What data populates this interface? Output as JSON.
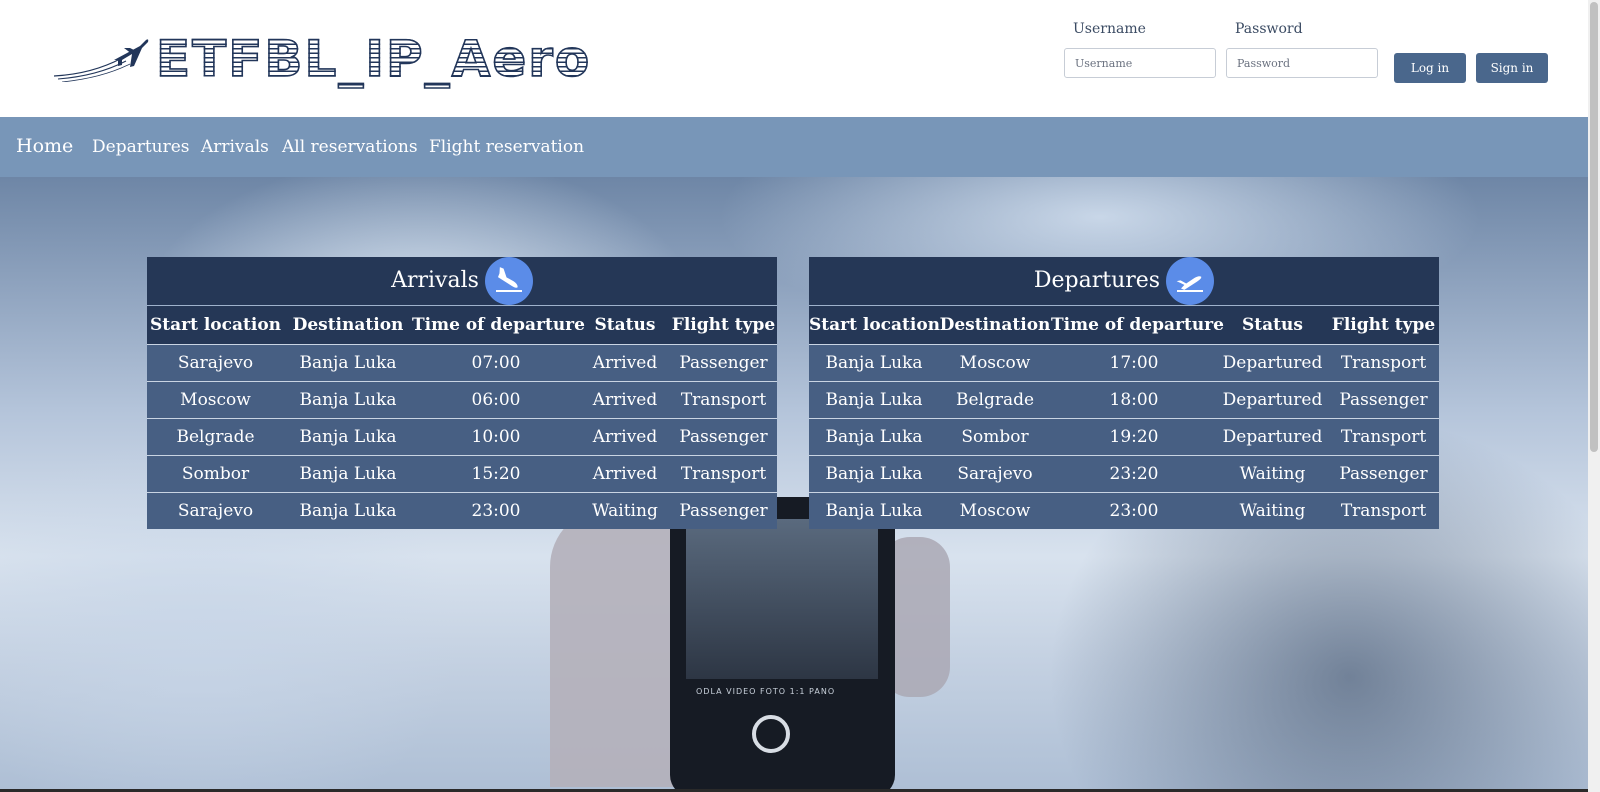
{
  "brand": {
    "name": "ETFBL_IP_Aero"
  },
  "login": {
    "username_label": "Username",
    "username_placeholder": "Username",
    "password_label": "Password",
    "password_placeholder": "Password",
    "login_button": "Log in",
    "signin_button": "Sign in"
  },
  "nav": {
    "home": "Home",
    "departures": "Departures",
    "arrivals": "Arrivals",
    "all_reservations": "All reservations",
    "flight_reservation": "Flight reservation"
  },
  "hero": {
    "phone_modes": "ODLA  VIDEO  FOTO  1:1  PANO"
  },
  "arrivals": {
    "title": "Arrivals",
    "icon": "airplane-landing-icon",
    "columns": [
      "Start location",
      "Destination",
      "Time of departure",
      "Status",
      "Flight type"
    ],
    "rows": [
      [
        "Sarajevo",
        "Banja Luka",
        "07:00",
        "Arrived",
        "Passenger"
      ],
      [
        "Moscow",
        "Banja Luka",
        "06:00",
        "Arrived",
        "Transport"
      ],
      [
        "Belgrade",
        "Banja Luka",
        "10:00",
        "Arrived",
        "Passenger"
      ],
      [
        "Sombor",
        "Banja Luka",
        "15:20",
        "Arrived",
        "Transport"
      ],
      [
        "Sarajevo",
        "Banja Luka",
        "23:00",
        "Waiting",
        "Passenger"
      ]
    ]
  },
  "departures": {
    "title": "Departures",
    "icon": "airplane-takeoff-icon",
    "columns": [
      "Start location",
      "Destination",
      "Time of departure",
      "Status",
      "Flight type"
    ],
    "rows": [
      [
        "Banja Luka",
        "Moscow",
        "17:00",
        "Departured",
        "Transport"
      ],
      [
        "Banja Luka",
        "Belgrade",
        "18:00",
        "Departured",
        "Passenger"
      ],
      [
        "Banja Luka",
        "Sombor",
        "19:20",
        "Departured",
        "Transport"
      ],
      [
        "Banja Luka",
        "Sarajevo",
        "23:20",
        "Waiting",
        "Passenger"
      ],
      [
        "Banja Luka",
        "Moscow",
        "23:00",
        "Waiting",
        "Transport"
      ]
    ]
  },
  "colors": {
    "brand_navy": "#22365a",
    "nav_bar": "#7896b8",
    "table_header": "#253756",
    "table_row": "#475f83",
    "button": "#4a678c",
    "icon_circle": "#5b8ce8"
  }
}
